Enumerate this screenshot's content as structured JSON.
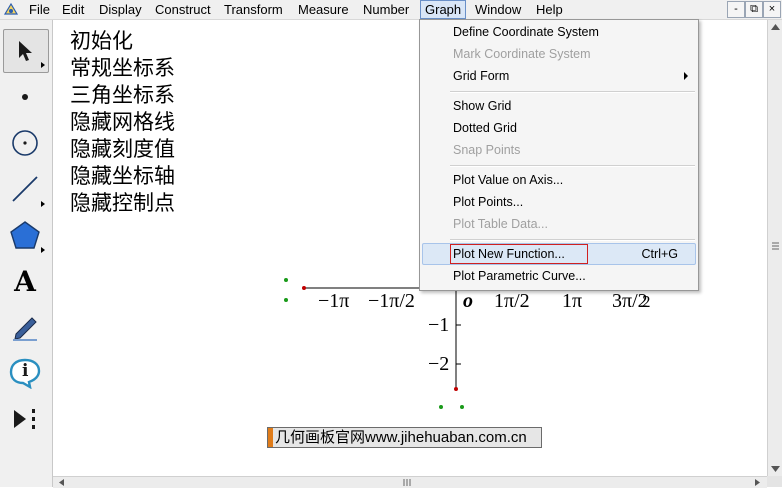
{
  "menubar": {
    "items": [
      "File",
      "Edit",
      "Display",
      "Construct",
      "Transform",
      "Measure",
      "Number",
      "Graph",
      "Window",
      "Help"
    ],
    "active": "Graph",
    "controls": {
      "minimize": "-",
      "restore": "⧉",
      "close": "×"
    }
  },
  "toolbar": {
    "tools": [
      "arrow-select-tool",
      "point-tool",
      "compass-tool",
      "straightedge-tool",
      "polygon-tool",
      "text-tool",
      "marker-tool",
      "information-tool",
      "custom-tool"
    ],
    "text_tool_glyph": "A",
    "info_glyph": "i"
  },
  "canvas": {
    "action_buttons": [
      "初始化",
      "常规坐标系",
      "三角坐标系",
      "隐藏网格线",
      "隐藏刻度值",
      "隐藏坐标轴",
      "隐藏控制点"
    ],
    "x_tick_labels": [
      "−1π",
      "−1π/2",
      "o",
      "1π/2",
      "1π",
      "3π/2"
    ],
    "x_tick_extra": "2",
    "y_tick_labels": [
      "−1",
      "−2"
    ],
    "watermark": "几何画板官网www.jihehuaban.com.cn"
  },
  "graph_menu": {
    "items": [
      {
        "label": "Define Coordinate System",
        "enabled": true
      },
      {
        "label": "Mark Coordinate System",
        "enabled": false
      },
      {
        "label": "Grid Form",
        "enabled": true,
        "submenu": true
      },
      {
        "label": "Show Grid",
        "enabled": true
      },
      {
        "label": "Dotted Grid",
        "enabled": true
      },
      {
        "label": "Snap Points",
        "enabled": false
      },
      {
        "label": "Plot Value on Axis...",
        "enabled": true
      },
      {
        "label": "Plot Points...",
        "enabled": true
      },
      {
        "label": "Plot Table Data...",
        "enabled": false
      },
      {
        "label": "Plot New Function...",
        "enabled": true,
        "shortcut": "Ctrl+G",
        "highlighted": true
      },
      {
        "label": "Plot Parametric Curve...",
        "enabled": true
      }
    ]
  },
  "colors": {
    "menu_highlight": "#dce8f6",
    "focus_box": "#d02020",
    "point_green": "#1a9a1a",
    "point_red": "#c00000",
    "watermark_accent": "#e07c1a"
  }
}
